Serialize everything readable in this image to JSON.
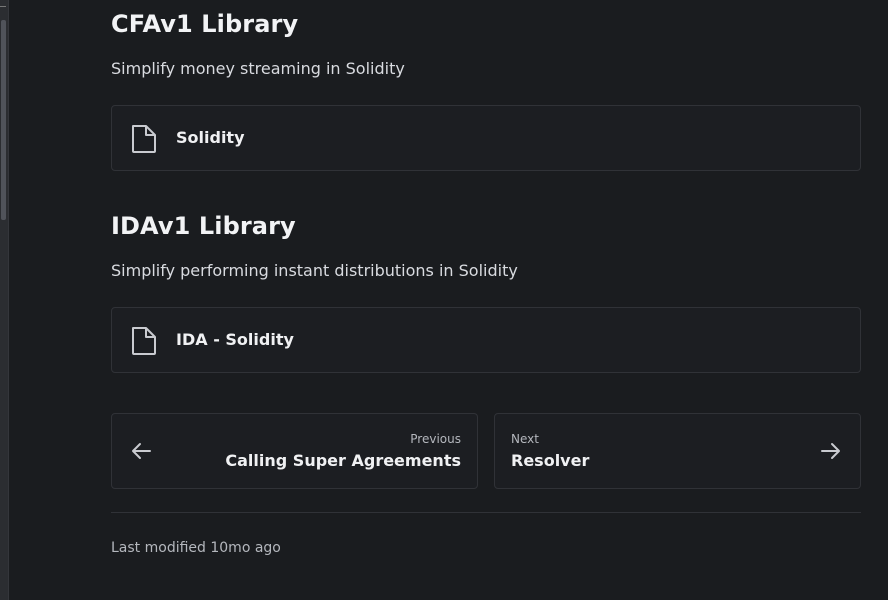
{
  "sections": [
    {
      "heading": "CFAv1 Library",
      "description": "Simplify money streaming in Solidity",
      "card_label": "Solidity",
      "card_icon": "document-icon"
    },
    {
      "heading": "IDAv1 Library",
      "description": "Simplify performing instant distributions in Solidity",
      "card_label": "IDA - Solidity",
      "card_icon": "document-icon"
    }
  ],
  "pagination": {
    "previous": {
      "caption": "Previous",
      "title": "Calling Super Agreements",
      "icon": "arrow-left-icon"
    },
    "next": {
      "caption": "Next",
      "title": "Resolver",
      "icon": "arrow-right-icon"
    }
  },
  "footer": {
    "last_modified": "Last modified 10mo ago"
  },
  "colors": {
    "background": "#1a1c1f",
    "card_border": "#303237",
    "text_primary": "#f0f1f3",
    "text_muted": "#b4b7bd"
  }
}
